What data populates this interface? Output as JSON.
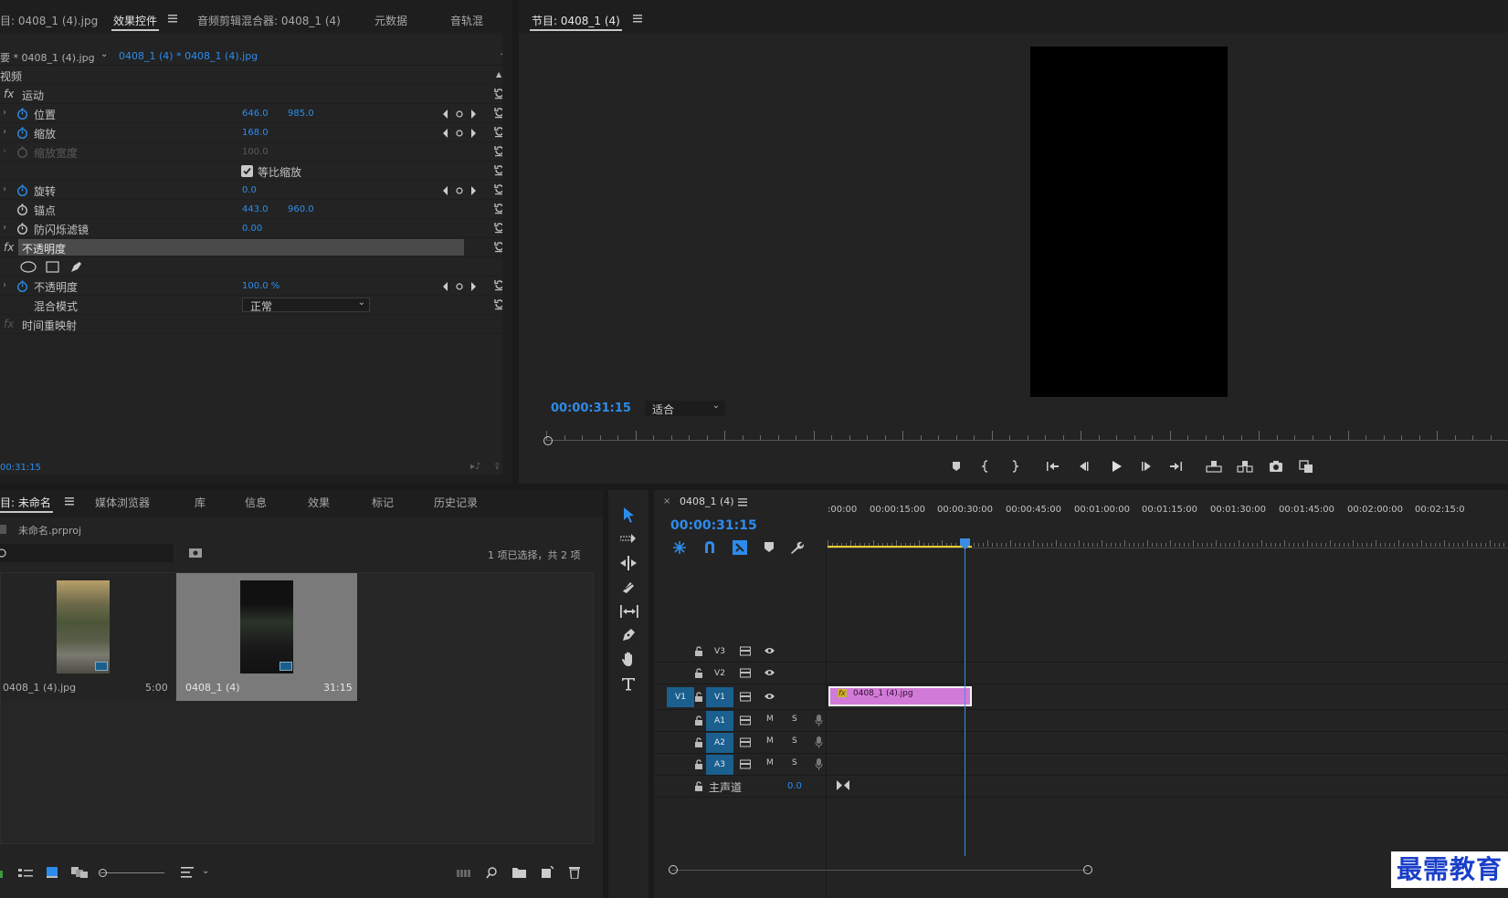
{
  "effect_controls": {
    "tabs": [
      "目: 0408_1 (4).jpg",
      "效果控件",
      "音频剪辑混合器: 0408_1 (4)",
      "元数据",
      "音轨混"
    ],
    "source_label": "要 * 0408_1 (4).jpg",
    "clip_label": "0408_1 (4) * 0408_1 (4).jpg",
    "section": "视频",
    "motion": "运动",
    "params": {
      "position": {
        "label": "位置",
        "x": "646.0",
        "y": "985.0"
      },
      "scale": {
        "label": "缩放",
        "value": "168.0"
      },
      "scale_width": {
        "label": "缩放宽度",
        "value": "100.0"
      },
      "uniform_scale": "等比缩放",
      "rotation": {
        "label": "旋转",
        "value": "0.0"
      },
      "anchor": {
        "label": "锚点",
        "x": "443.0",
        "y": "960.0"
      },
      "antiflicker": {
        "label": "防闪烁滤镜",
        "value": "0.00"
      }
    },
    "opacity_section": "不透明度",
    "opacity": {
      "label": "不透明度",
      "value": "100.0 %"
    },
    "blend": {
      "label": "混合模式",
      "value": "正常"
    },
    "time_remap": "时间重映射",
    "fx": "fx",
    "timecode": "00:31:15"
  },
  "program_monitor": {
    "title": "节目: 0408_1 (4)",
    "timecode": "00:00:31:15",
    "fit": "适合"
  },
  "project": {
    "tabs": [
      "目: 未命名",
      "媒体浏览器",
      "库",
      "信息",
      "效果",
      "标记",
      "历史记录"
    ],
    "file": "未命名.prproj",
    "selection": "1 项已选择，共 2 项",
    "items": [
      {
        "name": "0408_1 (4).jpg",
        "duration": "5:00"
      },
      {
        "name": "0408_1 (4)",
        "duration": "31:15"
      }
    ]
  },
  "timeline": {
    "title": "0408_1 (4)",
    "close": "×",
    "timecode": "00:00:31:15",
    "ruler": [
      ":00:00",
      "00:00:15:00",
      "00:00:30:00",
      "00:00:45:00",
      "00:01:00:00",
      "00:01:15:00",
      "00:01:30:00",
      "00:01:45:00",
      "00:02:00:00",
      "00:02:15:0"
    ],
    "video_tracks": [
      "V3",
      "V2",
      "V1"
    ],
    "source_patch": "V1",
    "audio_tracks": [
      "A1",
      "A2",
      "A3"
    ],
    "mute": "M",
    "solo": "S",
    "master": {
      "label": "主声道",
      "value": "0.0"
    },
    "clip": {
      "name": "0408_1 (4).jpg",
      "fx": "fx"
    }
  },
  "watermark": "最需教育",
  "colors": {
    "accent": "#2d8ceb",
    "clip": "#d27ad7",
    "playhead": "#3c8ce6",
    "work_area": "#e6d12c"
  }
}
